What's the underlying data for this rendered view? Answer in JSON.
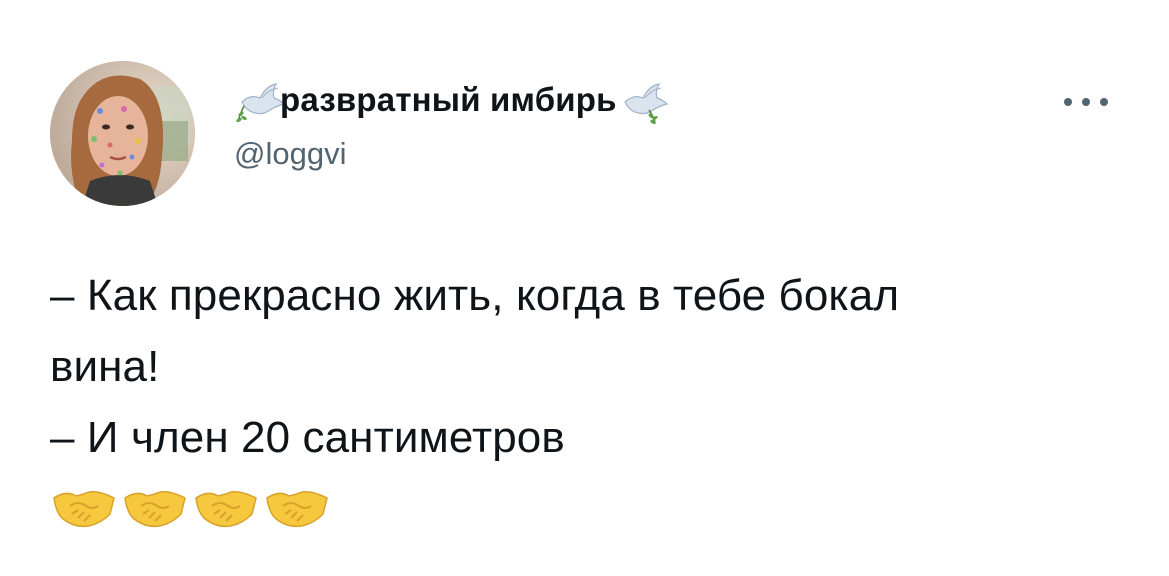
{
  "tweet": {
    "display_name": "развратный имбирь",
    "handle": "@loggvi",
    "lines": [
      "– Как прекрасно жить, когда в тебе бокал",
      "вина!",
      "– И член 20 сантиметров"
    ],
    "emoji": [
      "handshake",
      "handshake",
      "handshake",
      "handshake"
    ],
    "name_decoration_icon": "dove-with-olive-branch"
  },
  "colors": {
    "text_primary": "#0f1419",
    "text_secondary": "#536471",
    "background": "#ffffff"
  }
}
